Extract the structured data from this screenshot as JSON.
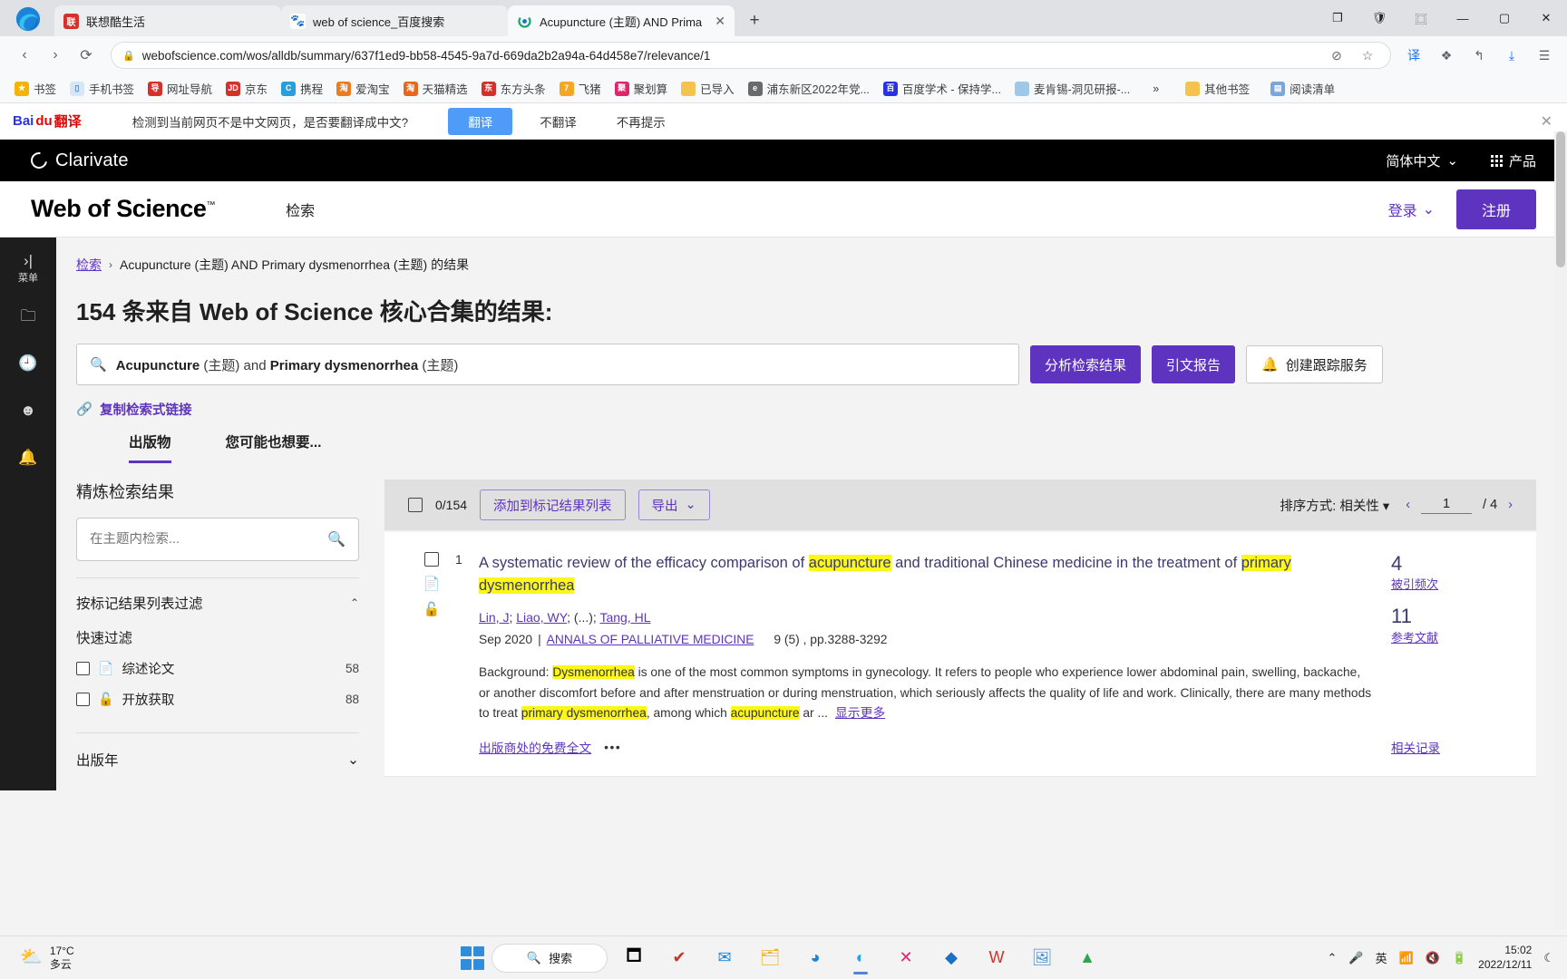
{
  "browser": {
    "tabs": [
      {
        "title": "联想酷生活",
        "favicon": "lenovo-icon",
        "active": false
      },
      {
        "title": "web of science_百度搜索",
        "favicon": "baidu-icon",
        "active": false
      },
      {
        "title": "Acupuncture (主题) AND Prima",
        "favicon": "wos-icon",
        "active": true
      }
    ],
    "new_tab_label": "+",
    "window_controls": {
      "restore_group": "❐",
      "split": "⿴",
      "shield": "🛡",
      "minimize": "—",
      "maximize": "▢",
      "close": "✕"
    },
    "nav": {
      "back": "‹",
      "forward": "›",
      "reload": "⟳"
    },
    "url": "webofscience.com/wos/alldb/summary/637f1ed9-bb58-4545-9a7d-669da2b2a94a-64d458e7/relevance/1",
    "lock_icon": "lock-icon",
    "toolbar_icons": [
      "browser-essentials-icon",
      "favorite-star-icon",
      "translate-icon",
      "collections-icon",
      "history-back-icon",
      "downloads-icon",
      "settings-menu-icon"
    ],
    "bookmarks": [
      {
        "label": "书签",
        "icon": "star-icon",
        "color": "#f5b301"
      },
      {
        "label": "手机书签",
        "icon": "phone-icon",
        "color": "#5aa9e6"
      },
      {
        "label": "网址导航",
        "icon": "hao-icon",
        "color": "#d6302a"
      },
      {
        "label": "京东",
        "icon": "jd-icon",
        "color": "#d6302a"
      },
      {
        "label": "携程",
        "icon": "ctrip-icon",
        "color": "#2a9ed8"
      },
      {
        "label": "爱淘宝",
        "icon": "taobao-icon",
        "color": "#ef7b21"
      },
      {
        "label": "天猫精选",
        "icon": "tmall-icon",
        "color": "#e8671c"
      },
      {
        "label": "东方头条",
        "icon": "dongfang-icon",
        "color": "#d6302a"
      },
      {
        "label": "飞猪",
        "icon": "fliggy-icon",
        "color": "#f5a623"
      },
      {
        "label": "聚划算",
        "icon": "juhuasuan-icon",
        "color": "#e0246e"
      },
      {
        "label": "已导入",
        "icon": "folder-icon",
        "color": "#f3c34d"
      },
      {
        "label": "浦东新区2022年党...",
        "icon": "edge-icon",
        "color": "#4a4a4a"
      },
      {
        "label": "百度学术 - 保持学...",
        "icon": "baidu-icon",
        "color": "#2932e1"
      },
      {
        "label": "麦肯锡-洞见研报-...",
        "icon": "page-icon",
        "color": "#9fc7e8"
      }
    ],
    "bookmarks_overflow": "»",
    "bookmarks_other": {
      "label": "其他书签",
      "icon": "folder-icon"
    },
    "reading_list": {
      "label": "阅读清单",
      "icon": "book-icon"
    }
  },
  "translate_bar": {
    "brand_bai": "Bai",
    "brand_du": "du",
    "brand_suffix": "翻译",
    "message": "检测到当前网页不是中文网页，是否要翻译成中文?",
    "translate_button": "翻译",
    "no_translate_button": "不翻译",
    "never_button": "不再提示",
    "close": "✕"
  },
  "clarivate": {
    "brand": "Clarivate",
    "language": "简体中文",
    "language_caret": "⌄",
    "products": "产品"
  },
  "wos_header": {
    "logo": "Web of Science",
    "logo_tm": "™",
    "nav_search": "检索",
    "sign_in": "登录",
    "sign_in_caret": "⌄",
    "register": "注册"
  },
  "leftrail": {
    "toggle": {
      "label": "菜单",
      "icon": "expand-panel-icon"
    },
    "items": [
      {
        "icon": "folder-icon",
        "name": "marked-list"
      },
      {
        "icon": "history-icon",
        "name": "search-history"
      },
      {
        "icon": "profile-icon",
        "name": "profile"
      },
      {
        "icon": "bell-icon",
        "name": "alerts"
      }
    ]
  },
  "main": {
    "breadcrumb_root": "检索",
    "breadcrumb_chevron": "›",
    "breadcrumb_current": "Acupuncture (主题) AND Primary dysmenorrhea (主题) 的结果",
    "results_heading": "154 条来自 Web of Science 核心合集的结果:",
    "query_parts": {
      "term1": "Acupuncture",
      "field1": "(主题)",
      "operator": "and",
      "term2": "Primary dysmenorrhea",
      "field2": "(主题)"
    },
    "analyze_button": "分析检索结果",
    "citation_report_button": "引文报告",
    "create_alert_button": "创建跟踪服务",
    "copy_query_link": "复制检索式链接",
    "tabs": [
      {
        "label": "出版物",
        "active": true
      },
      {
        "label": "您可能也想要...",
        "active": false
      }
    ]
  },
  "refine": {
    "title": "精炼检索结果",
    "search_placeholder": "在主题内检索...",
    "section_marked": "按标记结果列表过滤",
    "section_marked_caret": "⌃",
    "quick_filters_label": "快速过滤",
    "filters": [
      {
        "label": "综述论文",
        "count": "58",
        "icon": "document-icon"
      },
      {
        "label": "开放获取",
        "count": "88",
        "icon": "open-lock-icon"
      }
    ],
    "section_pubyear": "出版年",
    "section_pubyear_caret": "⌄"
  },
  "results_toolbar": {
    "selected_count": "0/154",
    "add_to_marked": "添加到标记结果列表",
    "export": "导出",
    "export_caret": "⌄",
    "sort_label": "排序方式: 相关性",
    "sort_caret": "▾",
    "prev": "‹",
    "page_current": "1",
    "page_total": "/ 4",
    "next": "›"
  },
  "records": [
    {
      "index": "1",
      "title_seg1": "A systematic review of the efficacy comparison of ",
      "title_hl1": "acupuncture",
      "title_seg2": " and traditional Chinese medicine in the treatment of ",
      "title_hl2": "primary",
      "title_seg3": " ",
      "title_hl3": "dysmenorrhea",
      "authors": "Lin, J; Liao, WY; (...); Tang, HL",
      "author_list": [
        "Lin, J",
        "Liao, WY",
        "(...)",
        "Tang, HL"
      ],
      "date": "Sep 2020",
      "journal": "ANNALS OF PALLIATIVE MEDICINE",
      "pages": "9 (5) , pp.3288-3292",
      "abstract_label": "Background: ",
      "abs_hl1": "Dysmenorrhea",
      "abs_seg1": " is one of the most common symptoms in gynecology. It refers to people who experience lower abdominal pain, swelling, backache, or another discomfort before and after menstruation or during menstruation, which seriously affects the quality of life and work. Clinically, there are many methods to treat ",
      "abs_hl2": "primary dysmenorrhea",
      "abs_seg2": ", among which ",
      "abs_hl3": "acupuncture",
      "abs_seg3": " ar ...",
      "show_more": "显示更多",
      "free_fulltext": "出版商处的免费全文",
      "more_dots": "•••",
      "times_cited_num": "4",
      "times_cited_label": "被引频次",
      "references_num": "11",
      "references_label": "参考文献",
      "related_records": "相关记录"
    }
  ],
  "taskbar": {
    "weather_temp": "17°C",
    "weather_desc": "多云",
    "weather_icon": "partly-cloudy-icon",
    "search_label": "搜索",
    "search_icon": "search-icon",
    "apps": [
      {
        "icon": "task-view-icon",
        "name": "task-view"
      },
      {
        "icon": "wechat-icon",
        "name": "wechat"
      },
      {
        "icon": "mail-icon",
        "name": "mail"
      },
      {
        "icon": "file-explorer-icon",
        "name": "file-explorer"
      },
      {
        "icon": "edge-icon",
        "name": "edge"
      },
      {
        "icon": "edge-dev-icon",
        "name": "edge-active"
      },
      {
        "icon": "x-app-icon",
        "name": "x-app"
      },
      {
        "icon": "blue-app-icon",
        "name": "blue-app"
      },
      {
        "icon": "wps-icon",
        "name": "wps"
      },
      {
        "icon": "photos-icon",
        "name": "photos"
      },
      {
        "icon": "green-app-icon",
        "name": "green-app"
      }
    ],
    "tray": {
      "chevron": "⌃",
      "mic": "mic-icon",
      "ime": "英",
      "wifi": "wifi-icon",
      "volume": "volume-muted-icon",
      "battery": "battery-icon",
      "time": "15:02",
      "date": "2022/12/11",
      "moon": "☾"
    }
  }
}
